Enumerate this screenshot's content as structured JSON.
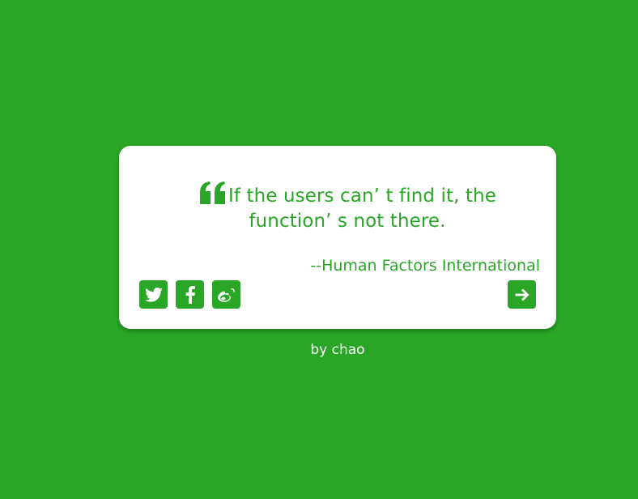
{
  "quote": {
    "text": "If the users can’ t find it, the function’ s not there.",
    "author": "--Human Factors International",
    "icon": "quote-left-icon"
  },
  "social": [
    {
      "name": "twitter",
      "icon": "twitter-icon"
    },
    {
      "name": "facebook",
      "icon": "facebook-icon"
    },
    {
      "name": "weibo",
      "icon": "weibo-icon"
    }
  ],
  "next_button": {
    "icon": "arrow-right-icon"
  },
  "byline": "by chao",
  "colors": {
    "background": "#2aa627",
    "card": "#ffffff",
    "accent": "#2aa627"
  }
}
